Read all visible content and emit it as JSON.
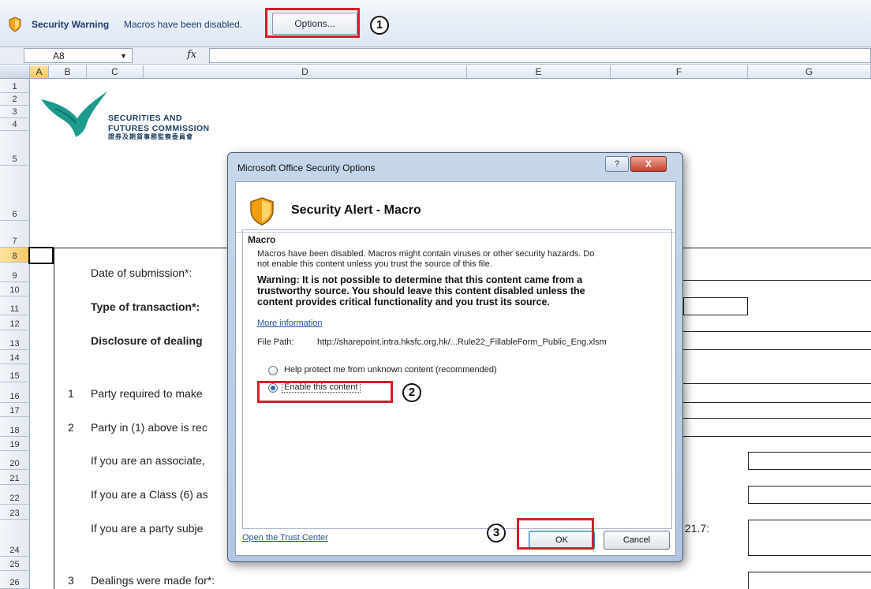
{
  "security_bar": {
    "title": "Security Warning",
    "message": "Macros have been disabled.",
    "options_label": "Options...",
    "step_1": "1"
  },
  "formula_bar": {
    "name_box": "A8",
    "fx_label": "fx"
  },
  "columns": [
    "A",
    "B",
    "C",
    "D",
    "E",
    "F",
    "G"
  ],
  "rows": [
    "1",
    "2",
    "3",
    "4",
    "5",
    "6",
    "7",
    "8",
    "9",
    "10",
    "11",
    "12",
    "13",
    "14",
    "15",
    "16",
    "17",
    "18",
    "19",
    "20",
    "21",
    "22",
    "23",
    "24",
    "25",
    "26"
  ],
  "sheet": {
    "logo_line1": "SECURITIES AND",
    "logo_line2": "FUTURES COMMISSION",
    "logo_line3": "證券及期貨事務監察委員會",
    "date_label": "Date of submission*:",
    "type_label": "Type of transaction*:",
    "disclosure_label": "Disclosure of dealing",
    "item1_num": "1",
    "item1_text": "Party required to make",
    "item2_num": "2",
    "item2_text": "Party in (1) above is rec",
    "associate_text": "If you are an associate,",
    "class6_text": "If you are a Class (6) as",
    "party_subject_text": "If you are a party subje",
    "rule_ref": "21.7:",
    "item3_num": "3",
    "item3_text": "Dealings were made for*:"
  },
  "dialog": {
    "title": "Microsoft Office Security Options",
    "help_label": "?",
    "close_label": "X",
    "alert_title": "Security Alert - Macro",
    "section_title": "Macro",
    "desc_line1": "Macros have been disabled. Macros might contain viruses or other security hazards. Do",
    "desc_line2": "not enable this content unless you trust the source of this file.",
    "warn_line1": "Warning: It is not possible to determine that this content came from a",
    "warn_line2": "trustworthy source. You should leave this content disabled unless the",
    "warn_line3": "content provides critical functionality and you trust its source.",
    "more_info": "More information",
    "file_path_label": "File Path:",
    "file_path_value": "http://sharepoint.intra.hksfc.org.hk/...Rule22_FillableForm_Public_Eng.xlsm",
    "option_protect": "Help protect me from unknown content (recommended)",
    "option_enable": "Enable this content",
    "selected_option": "Enable this content",
    "step_2": "2",
    "step_3": "3",
    "ok_label": "OK",
    "cancel_label": "Cancel",
    "trust_center_link": "Open the Trust Center"
  },
  "colors": {
    "highlight_red": "#d0202a",
    "logo_teal": "#1c9a8c",
    "logo_navy": "#1d3f61",
    "link_blue": "#1f4fa8"
  },
  "icons": [
    "shield-icon",
    "dropdown-arrow-icon",
    "function-icon",
    "help-icon",
    "close-icon",
    "resize-grip-icon"
  ]
}
